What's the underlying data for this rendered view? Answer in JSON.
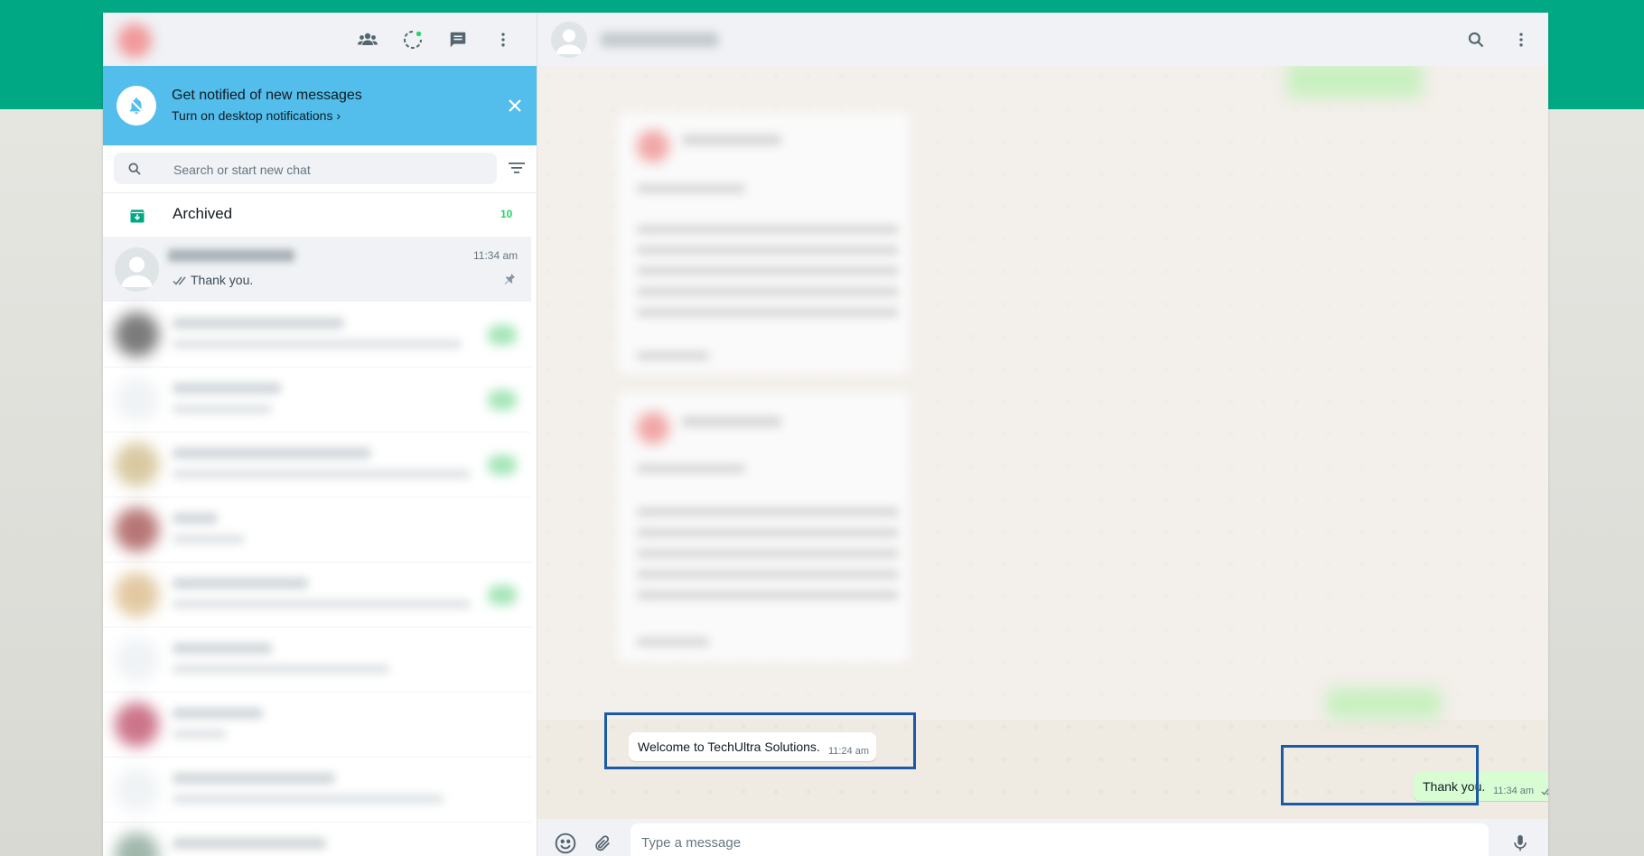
{
  "colors": {
    "brand_green": "#00a884",
    "notification_blue": "#53bdeb",
    "outgoing_bubble": "#d9fdd3",
    "highlight_box": "#1a5aa6",
    "unread_green": "#25d366"
  },
  "left_header": {
    "icons": [
      "communities-icon",
      "status-icon",
      "new-chat-icon",
      "menu-icon"
    ]
  },
  "notification": {
    "title": "Get notified of new messages",
    "link": "Turn on desktop notifications ›"
  },
  "search": {
    "placeholder": "Search or start new chat"
  },
  "archived": {
    "label": "Archived",
    "count": "10"
  },
  "chat_list": {
    "active_chat": {
      "time": "11:34 am",
      "preview": "Thank you."
    }
  },
  "conversation": {
    "messages": [
      {
        "direction": "incoming",
        "text": "Welcome to TechUltra Solutions.",
        "time": "11:24 am"
      },
      {
        "direction": "outgoing",
        "text": "Thank you.",
        "time": "11:34 am"
      }
    ]
  },
  "composer": {
    "placeholder": "Type a message"
  }
}
